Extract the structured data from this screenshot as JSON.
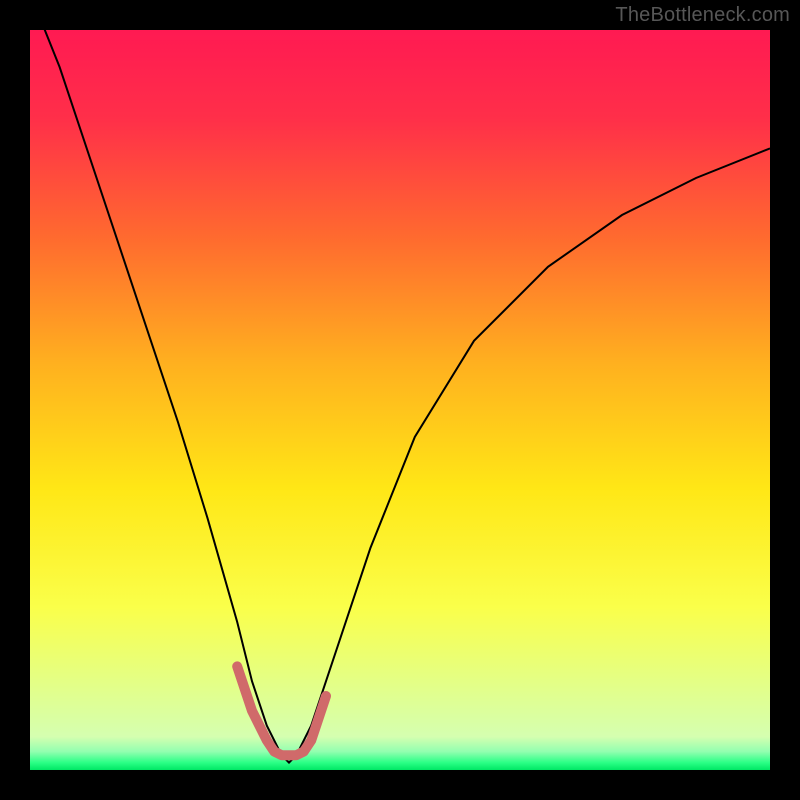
{
  "watermark": "TheBottleneck.com",
  "chart_data": {
    "type": "line",
    "title": "",
    "xlabel": "",
    "ylabel": "",
    "xlim": [
      0,
      100
    ],
    "ylim": [
      0,
      100
    ],
    "background_gradient": {
      "stops": [
        {
          "offset": 0.0,
          "color": "#ff1a52"
        },
        {
          "offset": 0.12,
          "color": "#ff2f49"
        },
        {
          "offset": 0.28,
          "color": "#ff6a2f"
        },
        {
          "offset": 0.45,
          "color": "#ffb01f"
        },
        {
          "offset": 0.62,
          "color": "#ffe716"
        },
        {
          "offset": 0.78,
          "color": "#faff4a"
        },
        {
          "offset": 0.88,
          "color": "#e4ff85"
        },
        {
          "offset": 0.955,
          "color": "#d5ffb0"
        },
        {
          "offset": 0.975,
          "color": "#93ffb0"
        },
        {
          "offset": 0.99,
          "color": "#2bff86"
        },
        {
          "offset": 1.0,
          "color": "#00e765"
        }
      ]
    },
    "series": [
      {
        "name": "bottleneck-curve",
        "stroke": "#000000",
        "stroke_width": 2,
        "x": [
          0,
          4,
          8,
          12,
          16,
          20,
          24,
          26,
          28,
          30,
          32,
          34,
          35,
          36,
          38,
          40,
          42,
          46,
          52,
          60,
          70,
          80,
          90,
          100
        ],
        "values": [
          105,
          95,
          83,
          71,
          59,
          47,
          34,
          27,
          20,
          12,
          6,
          2,
          1,
          2,
          6,
          12,
          18,
          30,
          45,
          58,
          68,
          75,
          80,
          84
        ]
      },
      {
        "name": "optimal-marker",
        "stroke": "#d06a6a",
        "stroke_width": 10,
        "linecap": "round",
        "x": [
          28,
          30,
          32,
          33,
          34,
          35,
          36,
          37,
          38,
          40
        ],
        "values": [
          14,
          8,
          4,
          2.5,
          2,
          2,
          2,
          2.5,
          4,
          10
        ]
      }
    ]
  }
}
